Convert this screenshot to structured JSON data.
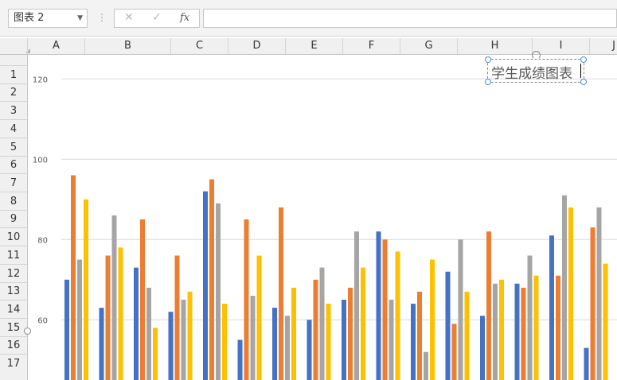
{
  "formula_bar": {
    "name_box": "图表 2",
    "cancel_icon": "✕",
    "enter_icon": "✓",
    "fx_label": "fx",
    "formula_value": ""
  },
  "columns": [
    "A",
    "B",
    "C",
    "D",
    "E",
    "F",
    "G",
    "H",
    "I",
    "J"
  ],
  "rows": [
    "1",
    "2",
    "3",
    "4",
    "5",
    "6",
    "7",
    "8",
    "9",
    "10",
    "11",
    "12",
    "13",
    "14",
    "15",
    "16",
    "17"
  ],
  "chart": {
    "title": "学生成绩图表",
    "colors": [
      "#4472c4",
      "#ed7d31",
      "#a5a5a5",
      "#ffc000"
    ]
  },
  "chart_data": {
    "type": "bar",
    "title": "学生成绩图表",
    "ylim": [
      45,
      126
    ],
    "yticks": [
      60,
      80,
      100,
      120
    ],
    "grid": true,
    "series": [
      {
        "values": [
          70,
          63,
          73,
          62,
          92,
          55,
          63,
          60,
          65,
          82,
          64,
          72,
          61,
          69,
          81,
          53
        ]
      },
      {
        "values": [
          96,
          76,
          85,
          76,
          95,
          85,
          88,
          70,
          68,
          80,
          67,
          59,
          82,
          68,
          71,
          83
        ]
      },
      {
        "values": [
          75,
          86,
          68,
          65,
          89,
          66,
          61,
          73,
          82,
          65,
          52,
          80,
          69,
          76,
          91,
          88
        ]
      },
      {
        "values": [
          90,
          78,
          58,
          67,
          64,
          76,
          68,
          64,
          73,
          77,
          75,
          67,
          70,
          71,
          88,
          74
        ]
      }
    ]
  }
}
